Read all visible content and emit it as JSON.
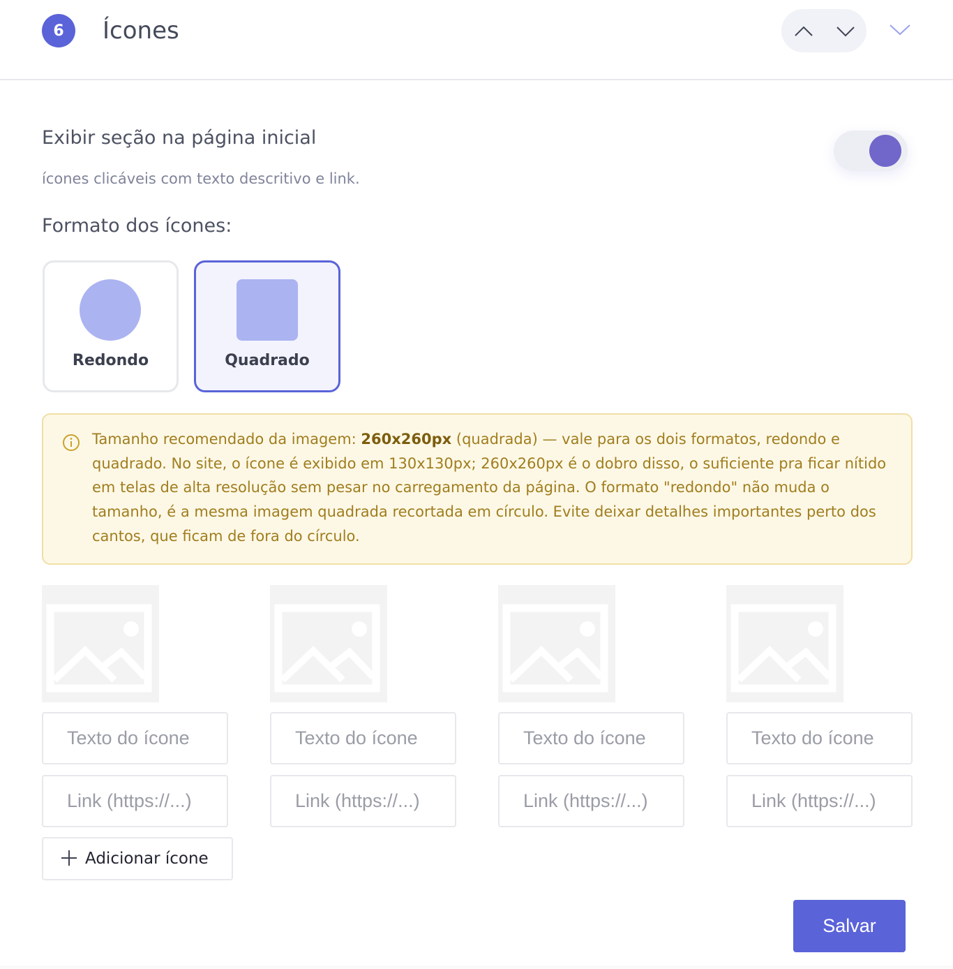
{
  "section": {
    "step_number": "6",
    "title": "Ícones"
  },
  "display_toggle": {
    "title": "Exibir seção na página inicial",
    "description": "ícones clicáveis com texto descritivo e link.",
    "enabled": true
  },
  "format": {
    "label": "Formato dos ícones:",
    "options": [
      {
        "label": "Redondo",
        "selected": false
      },
      {
        "label": "Quadrado",
        "selected": true
      }
    ]
  },
  "info": {
    "text_before": "Tamanho recomendado da imagem: ",
    "text_bold": "260x260px",
    "text_after": " (quadrada) — vale para os dois formatos, redondo e quadrado. No site, o ícone é exibido em 130x130px; 260x260px é o dobro disso, o suficiente pra ficar nítido em telas de alta resolução sem pesar no carregamento da página. O formato \"redondo\" não muda o tamanho, é a mesma imagem quadrada recortada em círculo. Evite deixar detalhes importantes perto dos cantos, que ficam de fora do círculo."
  },
  "icons": [
    {
      "text_placeholder": "Texto do ícone",
      "link_placeholder": "Link (https://...)",
      "text_value": "",
      "link_value": ""
    },
    {
      "text_placeholder": "Texto do ícone",
      "link_placeholder": "Link (https://...)",
      "text_value": "",
      "link_value": ""
    },
    {
      "text_placeholder": "Texto do ícone",
      "link_placeholder": "Link (https://...)",
      "text_value": "",
      "link_value": ""
    },
    {
      "text_placeholder": "Texto do ícone",
      "link_placeholder": "Link (https://...)",
      "text_value": "",
      "link_value": ""
    }
  ],
  "add_button": {
    "label": "Adicionar ícone",
    "icon": "plus-icon"
  },
  "save_button": {
    "label": "Salvar"
  },
  "colors": {
    "accent": "#5a63d8",
    "toggle_knob": "#7166c9",
    "shape_fill": "#abb3f1",
    "info_bg": "#fdf8e6",
    "info_border": "#f0dfa4",
    "info_text": "#a07d1e"
  }
}
